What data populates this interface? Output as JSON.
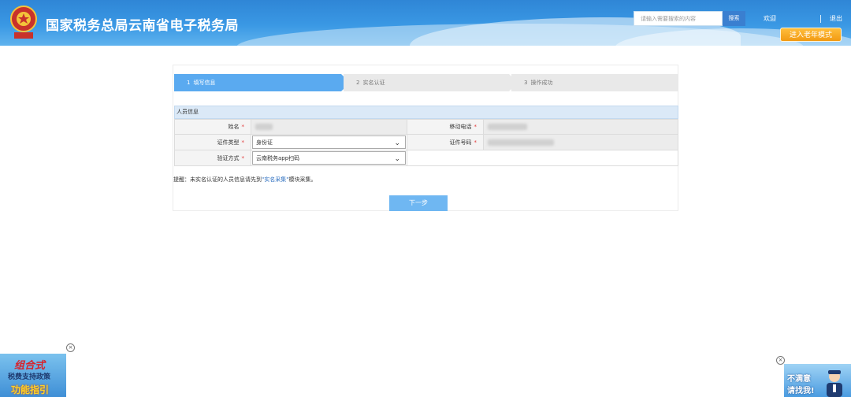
{
  "header": {
    "title": "国家税务总局云南省电子税务局",
    "search_placeholder": "请输入需要搜索的内容",
    "search_button": "搜索",
    "welcome": "欢迎",
    "logout": "退出",
    "elder_mode": "进入老年模式",
    "emblem_text": "中国税务"
  },
  "steps": [
    {
      "num": "1",
      "label": "填写信息",
      "state": "active"
    },
    {
      "num": "2",
      "label": "实名认证",
      "state": "pending"
    },
    {
      "num": "3",
      "label": "操作成功",
      "state": "pending"
    }
  ],
  "section": {
    "title": "人员信息"
  },
  "form": {
    "name_label": "姓名",
    "mobile_label": "移动电话",
    "id_type_label": "证件类型",
    "id_type_value": "身份证",
    "id_number_label": "证件号码",
    "verify_method_label": "验证方式",
    "verify_method_value": "云南税务app扫码",
    "required_mark": "*"
  },
  "reminder": {
    "prefix": "提醒：未实名认证的人员信息请先到",
    "link": "\"实名采集\"",
    "suffix": "模块采集。"
  },
  "next_button": "下一步",
  "ads": {
    "left": {
      "line1": "组合式",
      "line2": "税费支持政策",
      "line3": "功能指引",
      "close": "×"
    },
    "right": {
      "line1": "不满意",
      "line2": "请找我!",
      "close": "×"
    }
  },
  "colors": {
    "header_blue": "#3a98e4",
    "step_active": "#5aaaf0",
    "next_button": "#6fb7f2",
    "required": "#e23a3a",
    "elder_button": "#f29a12"
  }
}
